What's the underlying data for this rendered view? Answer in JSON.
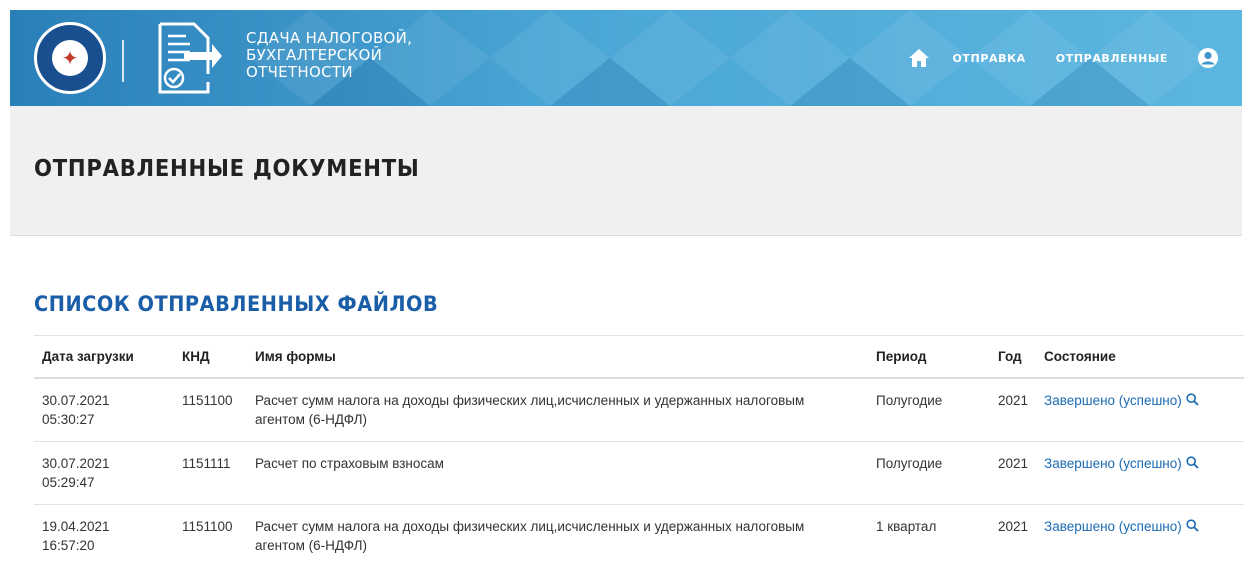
{
  "header": {
    "service_title_lines": [
      "СДАЧА НАЛОГОВОЙ,",
      "БУХГАЛТЕРСКОЙ",
      "ОТЧЕТНОСТИ"
    ],
    "emblem_icon": "fns-emblem-icon",
    "doc_icon": "tax-document-upload-icon",
    "nav": {
      "home_icon": "home-icon",
      "send_label": "ОТПРАВКА",
      "sent_label": "ОТПРАВЛЕННЫЕ",
      "user_icon": "user-icon"
    },
    "colors": {
      "primary": "#2a7fb8",
      "light": "#5cb6e0"
    }
  },
  "page": {
    "title": "ОТПРАВЛЕННЫЕ ДОКУМЕНТЫ"
  },
  "files": {
    "section_title": "СПИСОК ОТПРАВЛЕННЫХ ФАЙЛОВ",
    "columns": [
      "Дата загрузки",
      "КНД",
      "Имя формы",
      "Период",
      "Год",
      "Состояние"
    ],
    "rows": [
      {
        "date": "30.07.2021",
        "time": "05:30:27",
        "knd": "1151100",
        "form_line1": "Расчет сумм налога на доходы физических лиц,исчисленных и удержанных налоговым",
        "form_line2": "агентом (6-НДФЛ)",
        "period": "Полугодие",
        "year": "2021",
        "status": "Завершено (успешно)"
      },
      {
        "date": "30.07.2021",
        "time": "05:29:47",
        "knd": "1151111",
        "form_line1": "Расчет по страховым взносам",
        "form_line2": "",
        "period": "Полугодие",
        "year": "2021",
        "status": "Завершено (успешно)"
      },
      {
        "date": "19.04.2021",
        "time": "16:57:20",
        "knd": "1151100",
        "form_line1": "Расчет сумм налога на доходы физических лиц,исчисленных и удержанных налоговым",
        "form_line2": "агентом (6-НДФЛ)",
        "period": "1 квартал",
        "year": "2021",
        "status": "Завершено (успешно)"
      }
    ],
    "status_color": "#1a6bb5",
    "status_icon": "search-icon"
  }
}
